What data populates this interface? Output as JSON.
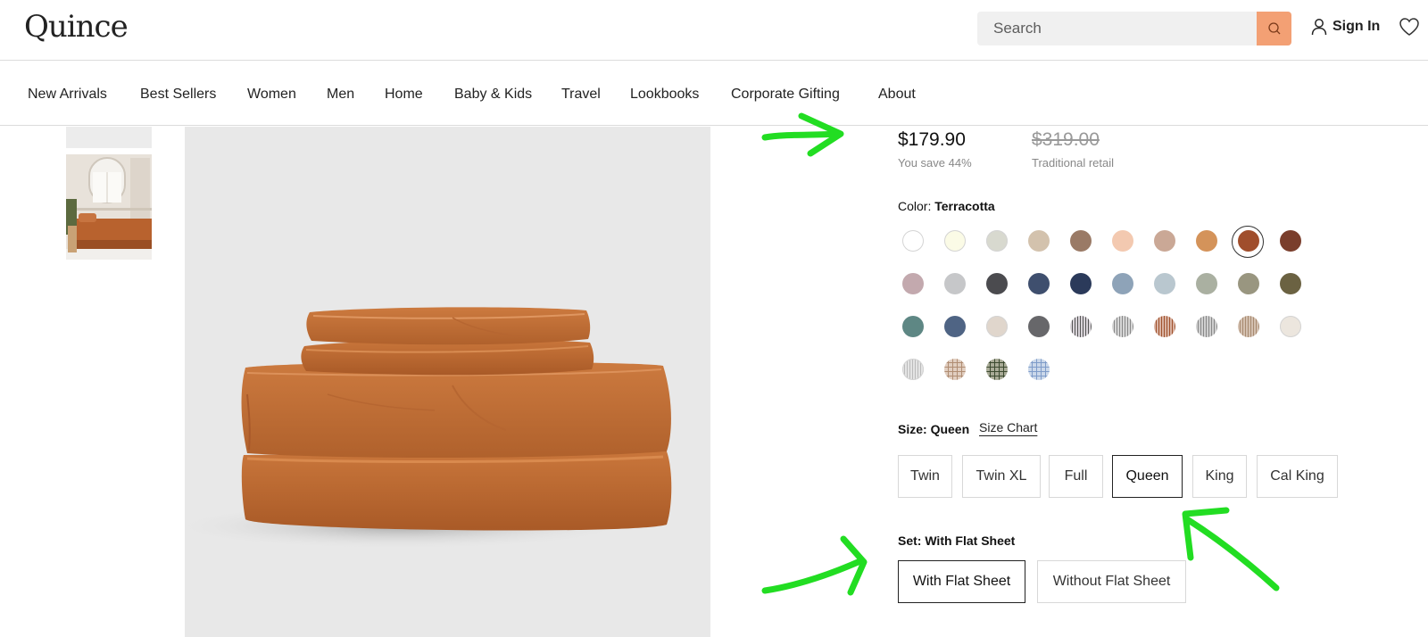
{
  "header": {
    "logo": "Quince",
    "search_placeholder": "Search",
    "search_icon": "search-icon",
    "sign_in_label": "Sign In",
    "user_icon": "user-icon",
    "wishlist_icon": "heart-icon",
    "accent_color": "#f3a074"
  },
  "nav": {
    "items": [
      "New Arrivals",
      "Best Sellers",
      "Women",
      "Men",
      "Home",
      "Baby & Kids",
      "Travel",
      "Lookbooks",
      "Corporate Gifting",
      "About"
    ]
  },
  "product": {
    "price": "$179.90",
    "original_price": "$319.00",
    "savings": "You save 44%",
    "retail_note": "Traditional retail",
    "color_label": "Color:",
    "color_value": "Terracotta",
    "selected_color": "Terracotta",
    "swatches": [
      {
        "color": "#ffffff"
      },
      {
        "color": "#fbfbe6"
      },
      {
        "color": "#d8d9cf"
      },
      {
        "color": "#d3c2ad"
      },
      {
        "color": "#9a7a66"
      },
      {
        "color": "#f3c9b0"
      },
      {
        "color": "#caa896"
      },
      {
        "color": "#d4935a"
      },
      {
        "color": "#a04e2c"
      },
      {
        "color": "#7a3e2c"
      },
      {
        "color": "#c3a9ae"
      },
      {
        "color": "#c6c7c9"
      },
      {
        "color": "#4b4b4f"
      },
      {
        "color": "#3f4f6e"
      },
      {
        "color": "#2b3a5a"
      },
      {
        "color": "#8ea3b8"
      },
      {
        "color": "#b9c7cf"
      },
      {
        "color": "#aab0a1"
      },
      {
        "color": "#999680"
      },
      {
        "color": "#6b6242"
      },
      {
        "color": "#5e8784"
      },
      {
        "color": "#4f6484"
      },
      {
        "color": "#e0d6cc"
      },
      {
        "color": "#67676a"
      },
      {
        "color": "#d9d4d9",
        "pattern": "stripe-dark"
      },
      {
        "color": "#d6d6d6",
        "pattern": "stripe-gray"
      },
      {
        "color": "#d9b3a3",
        "pattern": "stripe-rust"
      },
      {
        "color": "#cfcfcf",
        "pattern": "stripe-gray"
      },
      {
        "color": "#d3c0b0",
        "pattern": "stripe-tan"
      },
      {
        "color": "#ece6de"
      },
      {
        "color": "#e4e4e4",
        "pattern": "stripe-light"
      },
      {
        "color": "#e1cec0",
        "pattern": "plaid-tan"
      },
      {
        "color": "#a9ab97",
        "pattern": "plaid-green"
      },
      {
        "color": "#cbd8ea",
        "pattern": "plaid-blue"
      }
    ],
    "size_label": "Size: Queen",
    "size_chart_label": "Size Chart",
    "sizes": [
      "Twin",
      "Twin XL",
      "Full",
      "Queen",
      "King",
      "Cal King"
    ],
    "selected_size": "Queen",
    "set_label": "Set: With Flat Sheet",
    "sets": [
      "With Flat Sheet",
      "Without Flat Sheet"
    ],
    "selected_set": "With Flat Sheet"
  },
  "annotation_color": "#22dd22"
}
